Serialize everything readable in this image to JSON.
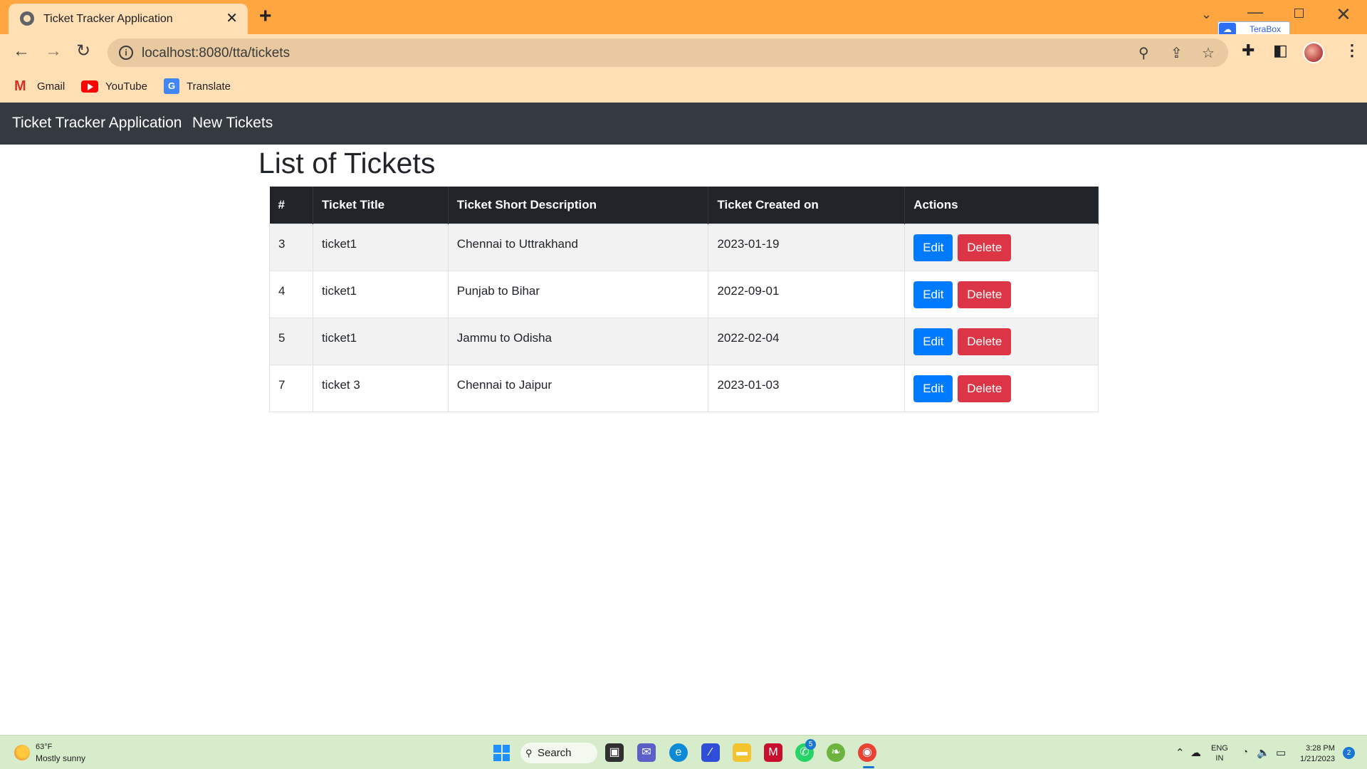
{
  "browser": {
    "tab_title": "Ticket Tracker Application",
    "url": "localhost:8080/tta/tickets",
    "extension_label": "TeraBox",
    "bookmarks": [
      {
        "label": "Gmail",
        "icon": "gmail-icon"
      },
      {
        "label": "YouTube",
        "icon": "youtube-icon"
      },
      {
        "label": "Translate",
        "icon": "translate-icon"
      }
    ]
  },
  "navbar": {
    "brand": "Ticket Tracker Application",
    "link": "New Tickets",
    "background": "#343a40"
  },
  "page": {
    "title": "List of Tickets"
  },
  "table": {
    "headers": [
      "#",
      "Ticket Title",
      "Ticket Short Description",
      "Ticket Created on",
      "Actions"
    ],
    "rows": [
      {
        "id": "3",
        "title": "ticket1",
        "description": "Chennai to Uttrakhand",
        "created": "2023-01-19"
      },
      {
        "id": "4",
        "title": "ticket1",
        "description": "Punjab to Bihar",
        "created": "2022-09-01"
      },
      {
        "id": "5",
        "title": "ticket1",
        "description": "Jammu to Odisha",
        "created": "2022-02-04"
      },
      {
        "id": "7",
        "title": "ticket 3",
        "description": "Chennai to Jaipur",
        "created": "2023-01-03"
      }
    ],
    "edit_label": "Edit",
    "delete_label": "Delete",
    "edit_color": "#007bff",
    "delete_color": "#dc3545"
  },
  "taskbar": {
    "weather_temp": "63°F",
    "weather_desc": "Mostly sunny",
    "search_label": "Search",
    "whatsapp_badge": "5",
    "lang_line1": "ENG",
    "lang_line2": "IN",
    "time": "3:28 PM",
    "date": "1/21/2023",
    "notification_count": "2"
  }
}
